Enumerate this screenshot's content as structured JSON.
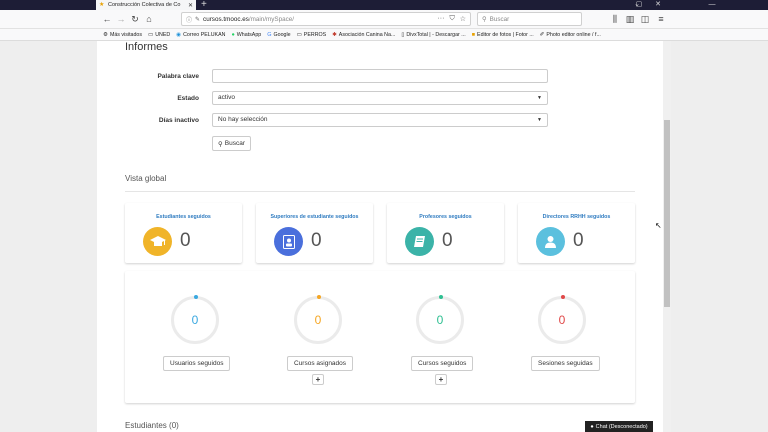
{
  "browser": {
    "tab_title": "Construcción Colectiva de Co",
    "url_domain": "cursos.tmooc.es",
    "url_path": "/main/mySpace/",
    "search_placeholder": "Buscar",
    "bookmarks": [
      {
        "label": "Más visitados",
        "icon": "gear-icon"
      },
      {
        "label": "UNED",
        "icon": "folder-icon"
      },
      {
        "label": "Correo PELUKAN",
        "icon": "mail-icon"
      },
      {
        "label": "WhatsApp",
        "icon": "whatsapp-icon"
      },
      {
        "label": "Google",
        "icon": "google-icon"
      },
      {
        "label": "PERROS",
        "icon": "folder-icon"
      },
      {
        "label": "Asociación Canina Na...",
        "icon": "paw-icon"
      },
      {
        "label": "DivxTotal | - Descargar ...",
        "icon": "page-icon"
      },
      {
        "label": "Editor de fotos | Fotor ...",
        "icon": "photo-icon"
      },
      {
        "label": "Photo editor online / f...",
        "icon": "brush-icon"
      }
    ]
  },
  "page": {
    "title": "Informes",
    "form": {
      "keyword_label": "Palabra clave",
      "keyword_value": "",
      "state_label": "Estado",
      "state_value": "activo",
      "inactive_label": "Días inactivo",
      "inactive_value": "No hay selección",
      "search_button": "Buscar"
    },
    "overview_title": "Vista global",
    "cards": [
      {
        "label": "Estudiantes seguidos",
        "value": "0",
        "icon": "graduation-cap-icon",
        "color": "#f0b429"
      },
      {
        "label": "Superiores de estudiante seguidos",
        "value": "0",
        "icon": "id-badge-icon",
        "color": "#4a6fdc"
      },
      {
        "label": "Profesores seguidos",
        "value": "0",
        "icon": "book-icon",
        "color": "#3bb3a8"
      },
      {
        "label": "Directores RRHH seguidos",
        "value": "0",
        "icon": "user-icon",
        "color": "#5bc0de"
      }
    ],
    "stats": [
      {
        "label": "Usuarios seguidos",
        "value": "0",
        "color": "#3aa8e0",
        "has_plus": false
      },
      {
        "label": "Cursos asignados",
        "value": "0",
        "color": "#f5a623",
        "has_plus": true
      },
      {
        "label": "Cursos seguidos",
        "value": "0",
        "color": "#2ebf91",
        "has_plus": true
      },
      {
        "label": "Sesiones seguidas",
        "value": "0",
        "color": "#e04848",
        "has_plus": false
      }
    ],
    "plus_label": "+",
    "students_title": "Estudiantes (0)"
  },
  "chat": {
    "label": "Chat (Desconectado)"
  }
}
